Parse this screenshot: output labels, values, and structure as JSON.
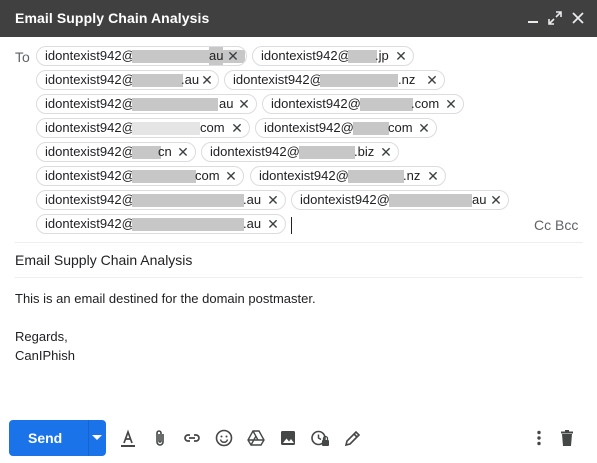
{
  "window": {
    "title": "Email Supply Chain Analysis",
    "controls": [
      "minimize-icon",
      "expand-icon",
      "close-icon"
    ]
  },
  "to": {
    "label": "To",
    "recipients": [
      {
        "prefix": "idontexist942@",
        "suffix": "au"
      },
      {
        "prefix": "idontexist942@",
        "suffix": ".jp"
      },
      {
        "prefix": "idontexist942@",
        "suffix": ".au"
      },
      {
        "prefix": "idontexist942@",
        "suffix": ".nz"
      },
      {
        "prefix": "idontexist942@",
        "suffix": "au"
      },
      {
        "prefix": "idontexist942@",
        "suffix": ".com"
      },
      {
        "prefix": "idontexist942@",
        "suffix": "com"
      },
      {
        "prefix": "idontexist942@",
        "suffix": "com"
      },
      {
        "prefix": "idontexist942@",
        "suffix": "cn"
      },
      {
        "prefix": "idontexist942@",
        "suffix": ".biz"
      },
      {
        "prefix": "idontexist942@",
        "suffix": "com"
      },
      {
        "prefix": "idontexist942@",
        "suffix": ".nz"
      },
      {
        "prefix": "idontexist942@",
        "suffix": ".au"
      },
      {
        "prefix": "idontexist942@",
        "suffix": "au"
      },
      {
        "prefix": "idontexist942@",
        "suffix": ".au"
      }
    ],
    "cc_bcc": "Cc Bcc"
  },
  "subject": "Email Supply Chain Analysis",
  "body": {
    "line1": "This is an email destined for the domain postmaster.",
    "line2": "Regards,",
    "line3": "CanIPhish"
  },
  "toolbar": {
    "send_label": "Send",
    "accent_color": "#1a73e8",
    "icons": [
      "formatting-icon",
      "attach-icon",
      "link-icon",
      "emoji-icon",
      "drive-icon",
      "photo-icon",
      "confidential-icon",
      "signature-icon",
      "more-options-icon",
      "delete-icon"
    ]
  }
}
